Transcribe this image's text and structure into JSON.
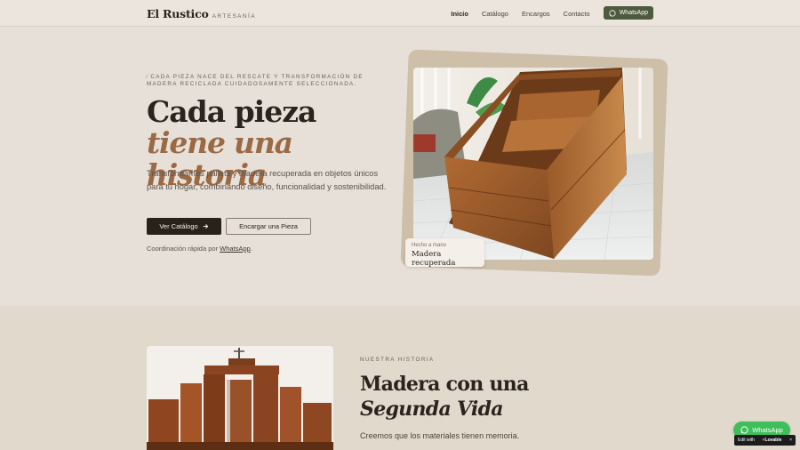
{
  "header": {
    "logo_name": "El Rustico",
    "logo_sub": "ARTESANÍA",
    "nav": [
      "Inicio",
      "Catálogo",
      "Encargos",
      "Contacto"
    ],
    "active_index": 0,
    "cta_label": "WhatsApp"
  },
  "hero": {
    "eyebrow": "CADA PIEZA NACE DEL RESCATE Y TRANSFORMACIÓN DE MADERA RECICLADA CUIDADOSAMENTE SELECCIONADA.",
    "title_line1": "Cada pieza",
    "title_line2": "tiene una historia",
    "description": "Transformamos pallets y madera recuperada en objetos únicos para tu hogar, combinando diseño, funcionalidad y sostenibilidad.",
    "primary_button": "Ver Catálogo",
    "secondary_button": "Encargar una Pieza",
    "quick_note_prefix": "Coordinación rápida por",
    "quick_note_link": "WhatsApp",
    "quick_note_suffix": ".",
    "badge_small": "Hecho a mano",
    "badge_big": "Madera recuperada"
  },
  "story": {
    "eyebrow": "NUESTRA HISTORIA",
    "title_line1": "Madera con una",
    "title_line2": "Segunda Vida",
    "description": "Creemos que los materiales tienen memoria."
  },
  "floating": {
    "whatsapp_label": "WhatsApp",
    "lovable_prefix": "Edit with",
    "lovable_brand": "Lovable",
    "lovable_close": "×"
  },
  "colors": {
    "accent": "#9a6a44",
    "whatsapp_green": "#3fbf5a",
    "nav_cta": "#4e5a3d",
    "primary_button": "#2a211b"
  }
}
